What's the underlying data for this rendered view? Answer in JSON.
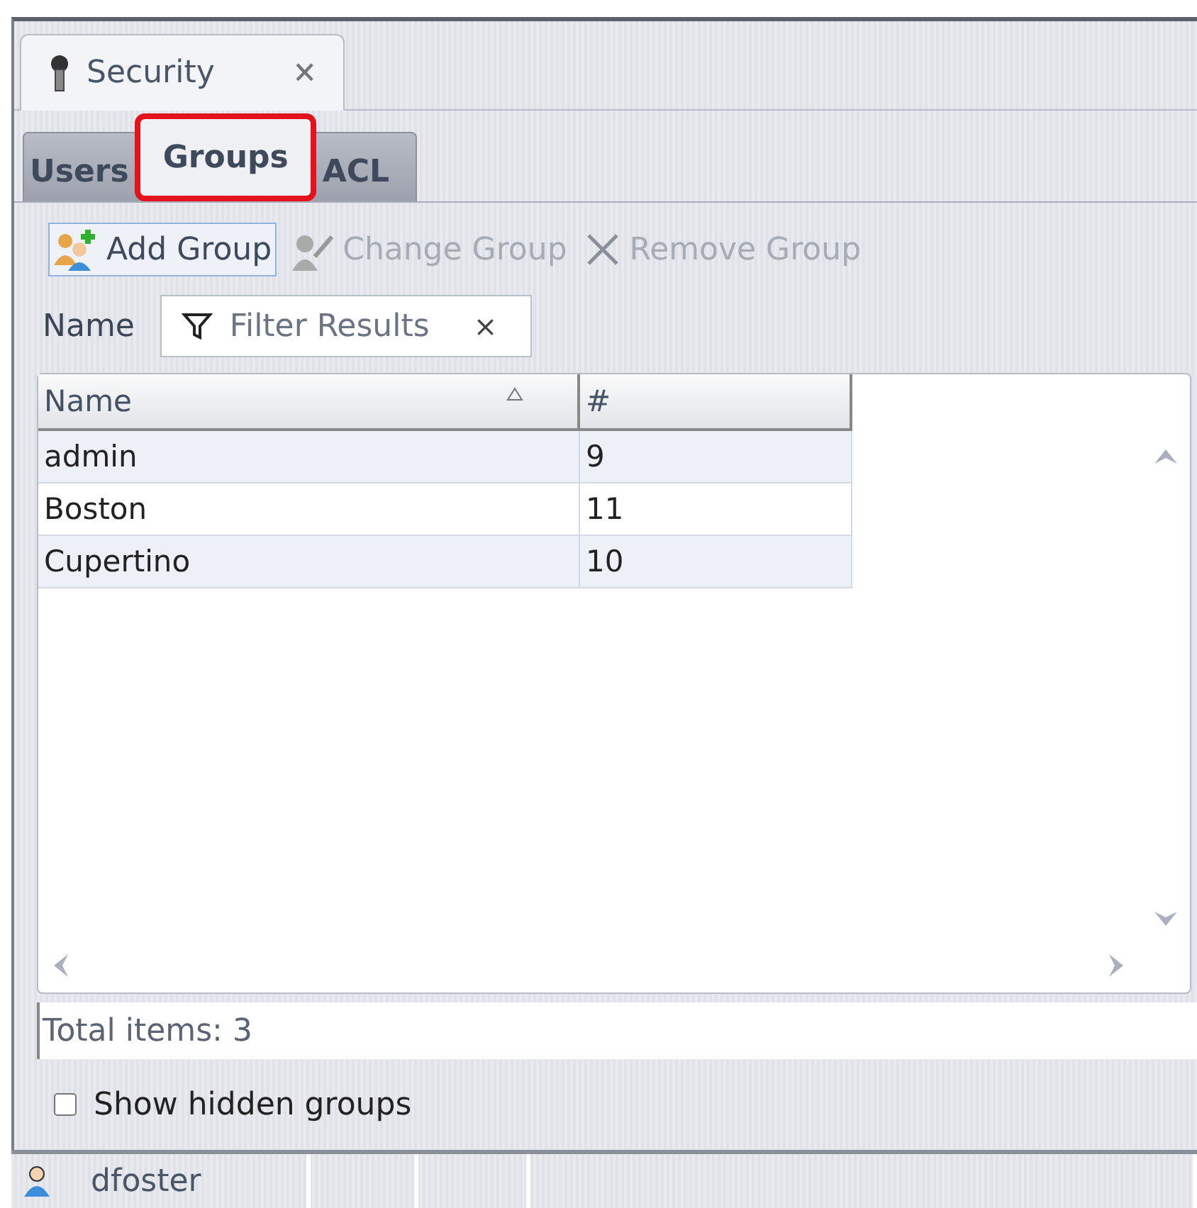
{
  "document_tab": {
    "title": "Security",
    "close": "🗙"
  },
  "tabs": [
    {
      "label": "Users",
      "selected": false
    },
    {
      "label": "Groups",
      "selected": true
    },
    {
      "label": "ACL",
      "selected": false
    }
  ],
  "toolbar": [
    {
      "kind": "add",
      "label": "Add Group",
      "disabled": false
    },
    {
      "kind": "edit",
      "label": "Change Group",
      "disabled": true
    },
    {
      "kind": "remove",
      "label": "Remove Group",
      "disabled": true
    }
  ],
  "filter": {
    "label": "Name",
    "placeholder": "Filter Results",
    "clear": "×"
  },
  "table": {
    "columns": [
      "Name",
      "#"
    ],
    "rows": [
      [
        "admin",
        "9"
      ],
      [
        "Boston",
        "11"
      ],
      [
        "Cupertino",
        "10"
      ]
    ]
  },
  "total": "Total items: 3",
  "show_hidden": {
    "label": "Show hidden groups",
    "checked": false
  },
  "status_bar": {
    "user": "dfoster"
  }
}
